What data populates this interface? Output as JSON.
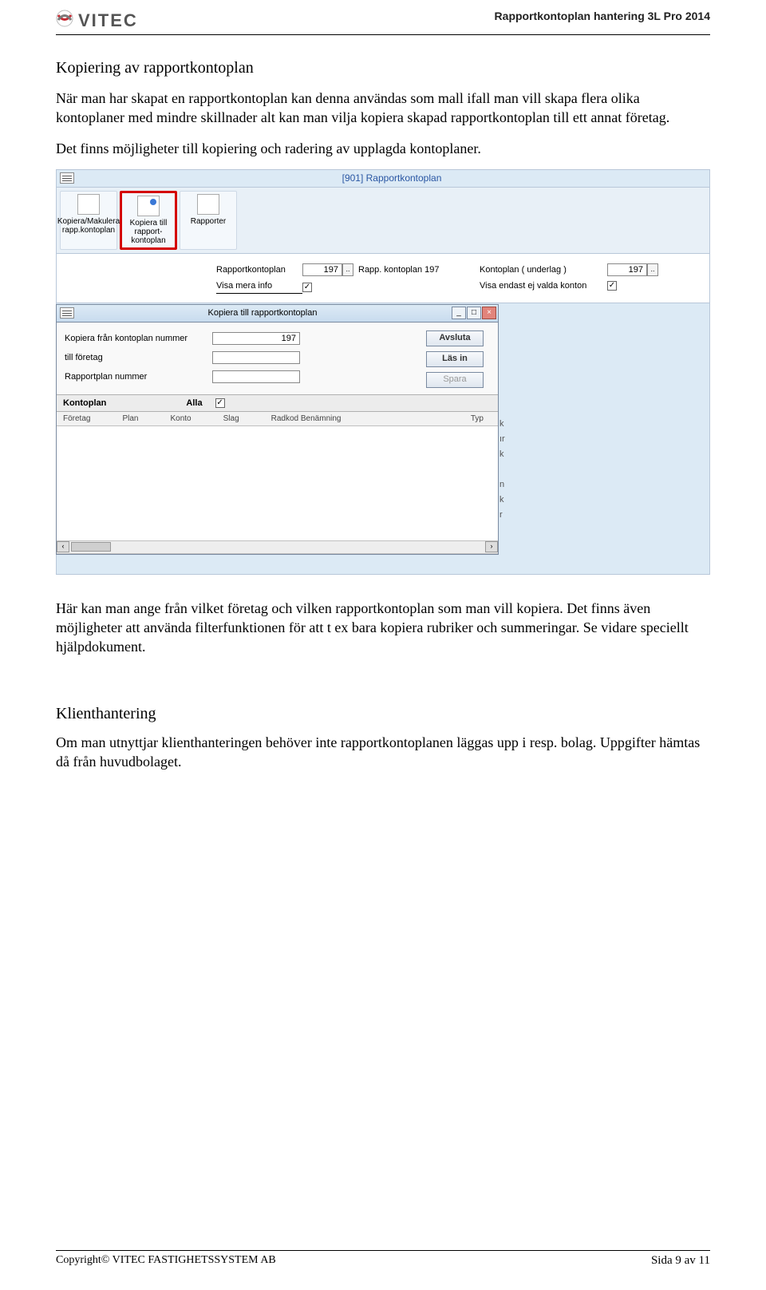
{
  "header": {
    "logo_text": "VITEC",
    "title": "Rapportkontoplan hantering 3L Pro 2014"
  },
  "section1": {
    "heading": "Kopiering av rapportkontoplan",
    "para1": "När man har skapat en rapportkontoplan kan denna användas som mall ifall man vill skapa flera olika kontoplaner med mindre skillnader alt kan man vilja kopiera skapad rapportkontoplan till ett annat företag.",
    "para2": "Det finns möjligheter till kopiering och radering av upplagda kontoplaner."
  },
  "app": {
    "title": "[901]  Rapportkontoplan",
    "ribbon": {
      "btn1_l1": "Kopiera/Makulera",
      "btn1_l2": "rapp.kontoplan",
      "btn2_l1": "Kopiera till",
      "btn2_l2": "rapport-",
      "btn2_l3": "kontoplan",
      "btn3": "Rapporter"
    },
    "form": {
      "rapportkontoplan_lbl": "Rapportkontoplan",
      "rapportkontoplan_val": "197",
      "rapportkontoplan_desc": "Rapp. kontoplan 197",
      "visa_mera_lbl": "Visa mera info",
      "kontoplan_underlag_lbl": "Kontoplan ( underlag )",
      "kontoplan_underlag_val": "197",
      "visa_endast_lbl": "Visa endast ej valda konton"
    },
    "dialog": {
      "title": "Kopiera till rapportkontoplan",
      "row1_lbl": "Kopiera från kontoplan nummer",
      "row1_val": "197",
      "row2_lbl": "till företag",
      "row3_lbl": "Rapportplan nummer",
      "btn_avsluta": "Avsluta",
      "btn_lasin": "Läs in",
      "btn_spara": "Spara",
      "kontoplan_lbl": "Kontoplan",
      "alla_lbl": "Alla",
      "cols": {
        "c1": "Företag",
        "c2": "Plan",
        "c3": "Konto",
        "c4": "Slag",
        "c5": "Radkod Benämning",
        "c6": "Typ"
      }
    },
    "behind_fragments": "\nk\nır\nk\n\nn\nk\nr"
  },
  "body2": {
    "p1": "Här kan man ange från vilket företag och vilken rapportkontoplan som man vill kopiera. Det finns även möjligheter att använda filterfunktionen för att t ex bara kopiera rubriker och summeringar. Se vidare speciellt hjälpdokument."
  },
  "section2": {
    "heading": "Klienthantering",
    "p1": "Om man utnyttjar klienthanteringen behöver inte rapportkontoplanen läggas upp i resp. bolag. Uppgifter hämtas då från huvudbolaget."
  },
  "footer": {
    "copyright_pre": "Copyright© V",
    "copyright_post": "ITEC FASTIGHETSSYSTEM AB",
    "page": "Sida 9 av 11"
  }
}
